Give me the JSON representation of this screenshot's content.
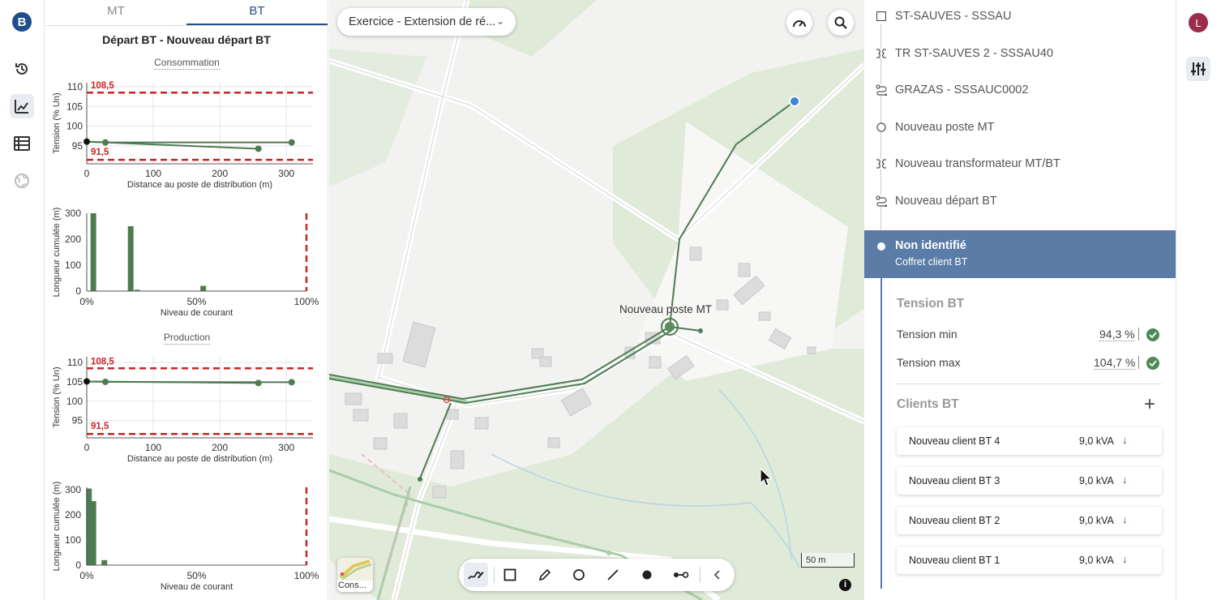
{
  "rail": {
    "logo": "B",
    "icons": [
      "history-icon",
      "chart-icon",
      "table-icon",
      "globe-icon"
    ]
  },
  "left_panel": {
    "tabs": [
      "MT",
      "BT"
    ],
    "active_tab": "BT",
    "title": "Départ BT - Nouveau départ BT",
    "consumption_label": "Consommation",
    "production_label": "Production"
  },
  "chart_data": [
    {
      "type": "line",
      "title": "Consommation",
      "xlabel": "Distance au poste de distribution (m)",
      "ylabel": "Tension (% Un)",
      "xticks": [
        "0",
        "100",
        "200",
        "300"
      ],
      "yticks": [
        "95",
        "100",
        "105",
        "110"
      ],
      "xlim": [
        0,
        340
      ],
      "ylim": [
        90.5,
        111
      ],
      "limits": {
        "max": "108,5",
        "min": "91,5"
      },
      "series": [
        {
          "x": [
            0,
            28,
            258,
            308
          ],
          "y": [
            96.1,
            95.9,
            94.3,
            95.9
          ]
        }
      ]
    },
    {
      "type": "bar",
      "xlabel": "Niveau de courant",
      "ylabel": "Longueur cumulée (m)",
      "xticks": [
        "0%",
        "50%",
        "100%"
      ],
      "yticks": [
        "0",
        "100",
        "200",
        "300"
      ],
      "ylim": [
        0,
        300
      ],
      "categories": [
        "3%",
        "20%",
        "23%",
        "53%"
      ],
      "values": [
        300,
        250,
        5,
        20
      ],
      "limit_label": "100%"
    },
    {
      "type": "line",
      "title": "Production",
      "xlabel": "Distance au poste de distribution (m)",
      "ylabel": "Tension (% Un)",
      "xticks": [
        "0",
        "100",
        "200",
        "300"
      ],
      "yticks": [
        "95",
        "105",
        "100",
        "110"
      ],
      "xlim": [
        0,
        340
      ],
      "ylim": [
        90.5,
        111.5
      ],
      "limits": {
        "max": "108,5",
        "min": "91,5"
      },
      "series": [
        {
          "x": [
            0,
            28,
            258,
            308
          ],
          "y": [
            105.1,
            105.0,
            104.7,
            104.9
          ]
        }
      ]
    },
    {
      "type": "bar",
      "xlabel": "Niveau de courant",
      "ylabel": "Longueur cumulée (m)",
      "xticks": [
        "0%",
        "50%",
        "100%"
      ],
      "yticks": [
        "0",
        "100",
        "200",
        "300"
      ],
      "ylim": [
        0,
        310
      ],
      "categories": [
        "1%",
        "3%",
        "8%"
      ],
      "values": [
        305,
        255,
        20
      ],
      "limit_label": "100%"
    }
  ],
  "map": {
    "exercise_dropdown": "Exercice - Extension de ré...",
    "label": "Nouveau poste MT",
    "scale": "50 m",
    "layer_toggle": "Cons..."
  },
  "tree": {
    "items": [
      {
        "label": "ST-SAUVES - SSSAU",
        "icon": "square-icon"
      },
      {
        "label": "TR ST-SAUVES 2 - SSSAU40",
        "icon": "transformer-icon"
      },
      {
        "label": "GRAZAS - SSSAUC0002",
        "icon": "feeder-icon"
      },
      {
        "label": "Nouveau poste MT",
        "icon": "circle-icon"
      },
      {
        "label": "Nouveau transformateur MT/BT",
        "icon": "transformer-icon"
      },
      {
        "label": "Nouveau départ BT",
        "icon": "feeder-icon"
      }
    ],
    "selected": {
      "title": "Non identifié",
      "subtitle": "Coffret client BT"
    }
  },
  "details": {
    "tension_title": "Tension BT",
    "tension_min_label": "Tension min",
    "tension_min_value": "94,3 %",
    "tension_max_label": "Tension max",
    "tension_max_value": "104,7 %",
    "clients_title": "Clients BT",
    "clients": [
      {
        "name": "Nouveau client BT 4",
        "power": "9,0 kVA"
      },
      {
        "name": "Nouveau client BT 3",
        "power": "9,0 kVA"
      },
      {
        "name": "Nouveau client BT 2",
        "power": "9,0 kVA"
      },
      {
        "name": "Nouveau client BT 1",
        "power": "9,0 kVA"
      }
    ]
  },
  "user": {
    "avatar": "L"
  },
  "colors": {
    "accent": "#1f4e8c",
    "selected": "#5a7ca6",
    "series": "#4d7c52",
    "limit": "#cc2222",
    "ok": "#4d8a55"
  }
}
